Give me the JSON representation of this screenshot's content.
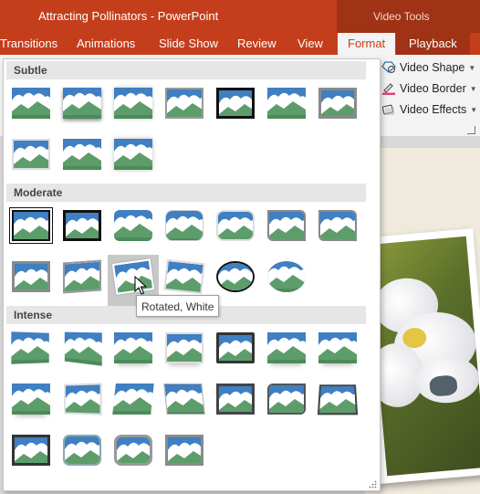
{
  "window": {
    "title": "Attracting Pollinators - PowerPoint",
    "context_label": "Video Tools"
  },
  "tabs": [
    {
      "label": "Transitions"
    },
    {
      "label": "Animations"
    },
    {
      "label": "Slide Show"
    },
    {
      "label": "Review"
    },
    {
      "label": "View"
    },
    {
      "label": "Format",
      "active": true
    },
    {
      "label": "Playback"
    }
  ],
  "ribbon": {
    "video_shape": "Video Shape",
    "video_border": "Video Border",
    "video_effects": "Video Effects",
    "accent": "#c43e1c"
  },
  "gallery": {
    "sections": [
      {
        "name": "Subtle",
        "count": 10
      },
      {
        "name": "Moderate",
        "count": 13
      },
      {
        "name": "Intense",
        "count": 18
      }
    ],
    "hovered_item": "Rotated, White",
    "tooltip": "Rotated, White"
  }
}
